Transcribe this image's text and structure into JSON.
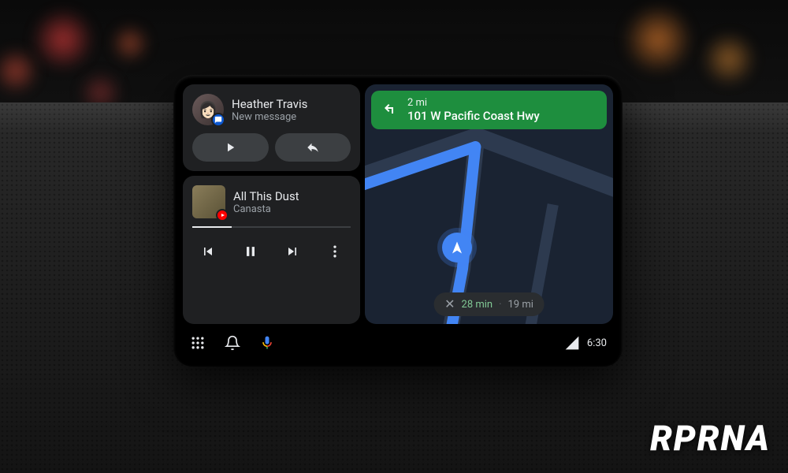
{
  "watermark": {
    "corner": "RPRNA",
    "center": "RPRNA"
  },
  "message_card": {
    "sender": "Heather Travis",
    "subtitle": "New message",
    "icon_badge": "messages-icon"
  },
  "music_card": {
    "track": "All This Dust",
    "artist": "Canasta",
    "progress_pct": 25,
    "source_badge": "youtube-music-icon"
  },
  "navigation": {
    "maneuver": "turn-left",
    "distance": "2 mi",
    "road": "101 W Pacific Coast Hwy",
    "eta_minutes": "28 min",
    "eta_distance": "19 mi"
  },
  "system_bar": {
    "clock": "6:30"
  },
  "colors": {
    "nav_banner": "#1e8e3e",
    "route": "#4285f4",
    "eta_time": "#81c995",
    "card_bg": "#1f2022"
  }
}
